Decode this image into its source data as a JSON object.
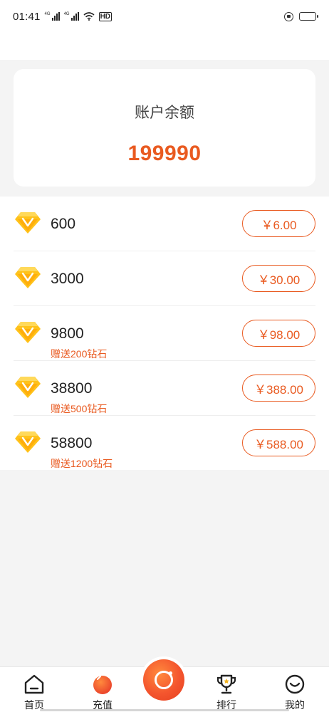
{
  "status_bar": {
    "time": "01:41",
    "signal_label_1": "4G",
    "signal_label_2": "4G",
    "hd_label": "HD"
  },
  "balance": {
    "label": "账户余额",
    "value": "199990"
  },
  "packages": [
    {
      "amount": "600",
      "bonus": "",
      "price": "￥6.00"
    },
    {
      "amount": "3000",
      "bonus": "",
      "price": "￥30.00"
    },
    {
      "amount": "9800",
      "bonus": "赠送200钻石",
      "price": "￥98.00"
    },
    {
      "amount": "38800",
      "bonus": "赠送500钻石",
      "price": "￥388.00"
    },
    {
      "amount": "58800",
      "bonus": "赠送1200钻石",
      "price": "￥588.00"
    }
  ],
  "nav": {
    "home": "首页",
    "recharge": "充值",
    "ranking": "排行",
    "mine": "我的"
  },
  "colors": {
    "accent": "#e95a20",
    "gem_gold": "#ffb300",
    "background": "#f4f4f4"
  }
}
